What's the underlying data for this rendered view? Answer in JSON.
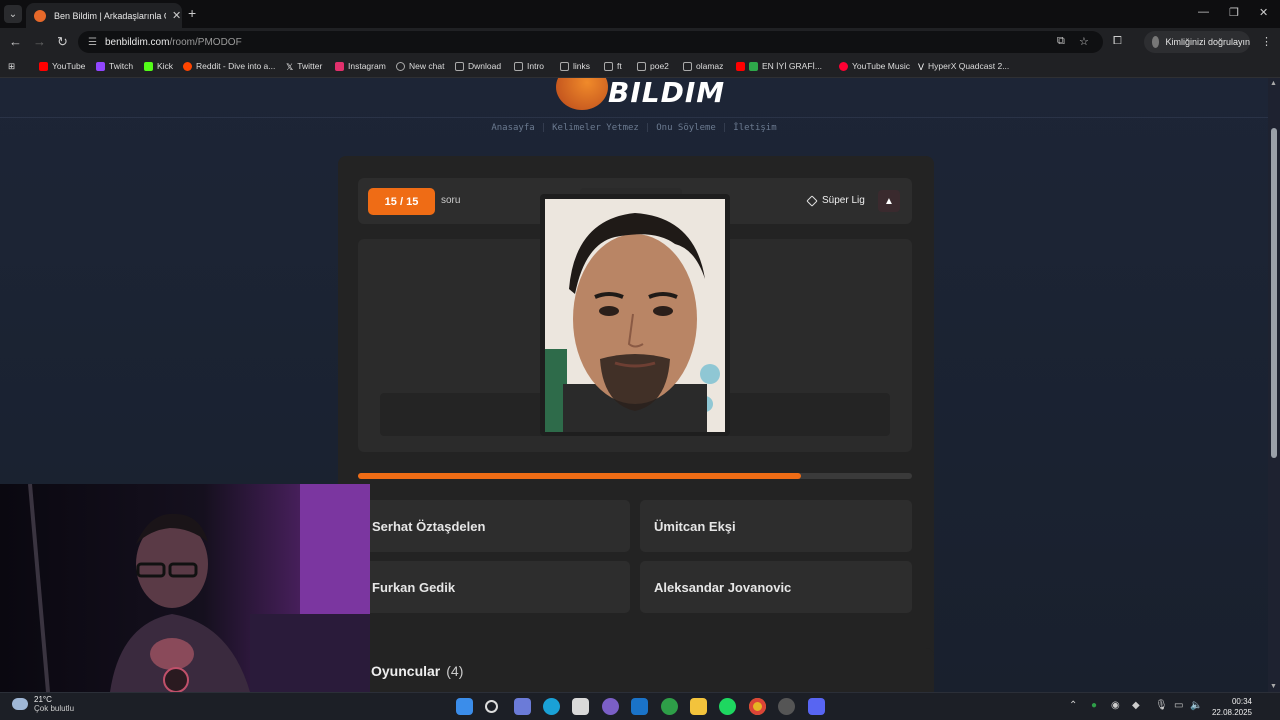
{
  "browser": {
    "tab_title": "Ben Bildim | Arkadaşlarınla Onli...",
    "tab_close": "✕",
    "new_tab": "+",
    "url_host": "benbildim.com",
    "url_path": "/room/PMODOF",
    "profile_label": "Kimliğinizi doğrulayın",
    "bookmarks": [
      {
        "label": "YouTube",
        "color": "#ff0000"
      },
      {
        "label": "Twitch",
        "color": "#9146ff"
      },
      {
        "label": "Kick",
        "color": "#53fc18"
      },
      {
        "label": "Reddit - Dive into a...",
        "color": "#ff4500"
      },
      {
        "label": "Twitter",
        "color": "#ffffff"
      },
      {
        "label": "Instagram",
        "color": "#e1306c"
      },
      {
        "label": "New chat",
        "color": "#aaaaaa"
      },
      {
        "label": "Dwnload",
        "color": "#aaaaaa"
      },
      {
        "label": "Intro",
        "color": "#aaaaaa"
      },
      {
        "label": "links",
        "color": "#aaaaaa"
      },
      {
        "label": "ft",
        "color": "#aaaaaa"
      },
      {
        "label": "poe2",
        "color": "#aaaaaa"
      },
      {
        "label": "olamaz",
        "color": "#aaaaaa"
      },
      {
        "label": "EN İYİ GRAFİ...",
        "color": "#ff0000"
      },
      {
        "label": "YouTube Music",
        "color": "#ff0033"
      },
      {
        "label": "HyperX Quadcast 2...",
        "color": "#e0e0e0"
      }
    ]
  },
  "site": {
    "logo_text": "BILDIM",
    "nav": [
      "Anasayfa",
      "Kelimeler Yetmez",
      "Onu Söyleme",
      "İletişim"
    ],
    "nav_sep": "|"
  },
  "question": {
    "counter": "15 / 15",
    "counter_suffix": "soru",
    "league": "Süper Lig",
    "report_icon": "▲",
    "progress": 0.8
  },
  "answers": [
    "Serhat Öztaşdelen",
    "Ümitcan Ekşi",
    "Furkan Gedik",
    "Aleksandar Jovanovic"
  ],
  "players": {
    "title": "Oyuncular",
    "count": "(4)"
  },
  "taskbar": {
    "temp": "21°C",
    "weather": "Çok bulutlu",
    "time": "00:34",
    "date": "22.08.2025"
  },
  "colors": {
    "accent": "#ef6c15",
    "card": "#232323",
    "page_bg": "#1b2333"
  }
}
